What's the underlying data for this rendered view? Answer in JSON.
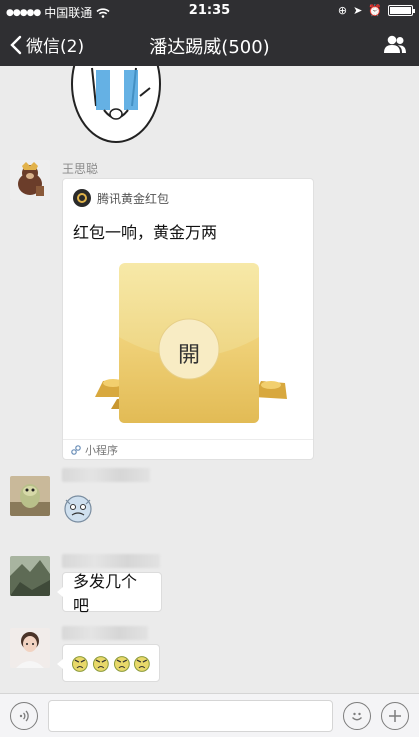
{
  "status": {
    "carrier": "中国联通",
    "time": "21:35",
    "battery_level": 1.0
  },
  "navbar": {
    "back_label": "微信(2)",
    "title": "潘达踢威(500)",
    "people_icon": "group-profile-icon"
  },
  "messages": {
    "m1": {
      "sender": "王思聪",
      "card_app": "腾讯黄金红包",
      "card_title": "红包一响，黄金万两",
      "envelope_char": "開",
      "mini_program_label": "小程序"
    },
    "m3": {
      "text": "多发几个吧"
    }
  },
  "colors": {
    "bar": "#2f2f32",
    "chat_bg": "#ebebeb",
    "gold": "#e9c766"
  }
}
